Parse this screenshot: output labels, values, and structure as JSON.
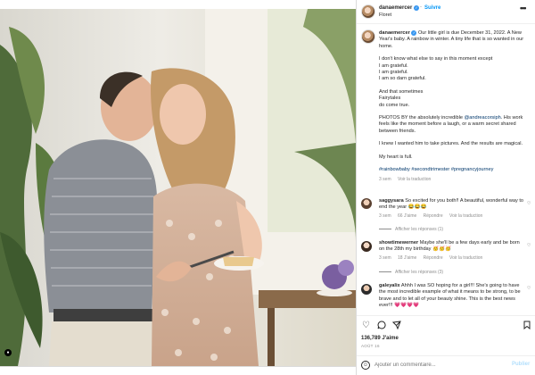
{
  "header": {
    "username": "danaemercer",
    "follow_label": "Suivre",
    "location": "Floret",
    "more_label": "•••"
  },
  "caption": {
    "username": "danaemercer",
    "text_first": "Our little girl is due December 31, 2022. A New Year's baby. A rainbow in winter. A tiny life that is so wanted in our home.",
    "p2": [
      "I don't know what else to say in this moment except",
      "I am grateful.",
      "I am grateful.",
      "I am so darn grateful."
    ],
    "p3": [
      "And that sometimes",
      "Fairytales",
      "do come true."
    ],
    "p4_before": "PHOTOS BY the absolutely incredible ",
    "p4_mention": "@andreacorsiph",
    "p4_after": ". His work feels like the moment before a laugh, or a warm secret shared between friends.",
    "p5": "I knew I wanted him to take pictures. And the results are magical.",
    "p6": "My heart is full.",
    "hashtags": "#rainbowbaby #secondtrimester #pregnancyjourney",
    "time": "3 sem",
    "translate": "Voir la traduction"
  },
  "comments": [
    {
      "username": "saggysara",
      "text": "So excited for you both!! A beautiful, wonderful way to end the year 😂😂😂",
      "time": "3 sem",
      "likes": "66 J'aime",
      "reply": "Répondre",
      "translate": "Voir la traduction",
      "replies": "Afficher les réponses (1)"
    },
    {
      "username": "showtimewerner",
      "text": "Maybe she'll be a few days early and be born on the 28th my birthday 🥳🥳🥳",
      "time": "3 sem",
      "likes": "18 J'aime",
      "reply": "Répondre",
      "translate": "Voir la traduction",
      "replies": "Afficher les réponses (3)"
    },
    {
      "username": "galeyalix",
      "text": "Ahhh I was SO hoping for a girl!!! She's going to have the most incredible example of what it means to be strong, to be brave and to let all of your beauty shine. This is the best news ever!!! 💗💗💗💗",
      "time": "",
      "likes": "",
      "reply": "",
      "translate": "",
      "replies": ""
    }
  ],
  "actions": {
    "likes": "136,789 J'aime",
    "date": "AOÛT 16"
  },
  "add_comment": {
    "placeholder": "Ajouter un commentaire...",
    "publish": "Publier"
  },
  "icons": {
    "like": "heart-icon",
    "comment": "comment-icon",
    "share": "share-icon",
    "save": "bookmark-icon",
    "emoji": "smiley-icon"
  },
  "colors": {
    "link": "#0095f6",
    "mention": "#00376b",
    "verified": "#3897f0",
    "muted": "#8e8e8e"
  }
}
